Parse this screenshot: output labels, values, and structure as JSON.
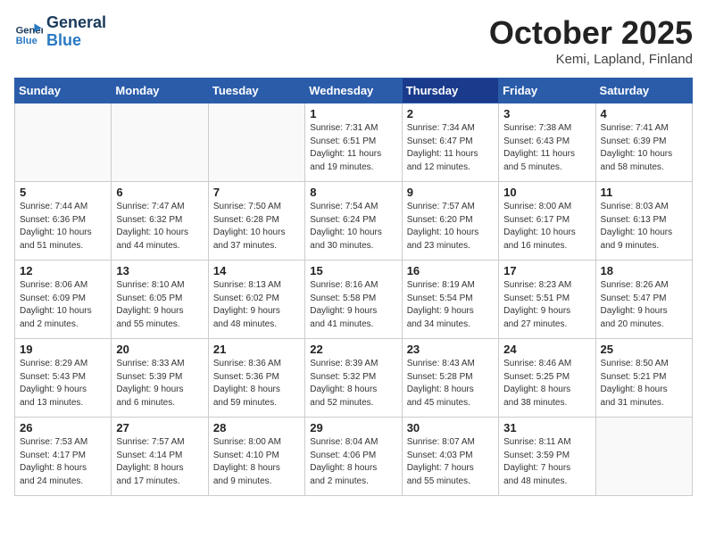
{
  "header": {
    "logo_line1": "General",
    "logo_line2": "Blue",
    "month": "October 2025",
    "location": "Kemi, Lapland, Finland"
  },
  "weekdays": [
    "Sunday",
    "Monday",
    "Tuesday",
    "Wednesday",
    "Thursday",
    "Friday",
    "Saturday"
  ],
  "weeks": [
    [
      {
        "day": "",
        "info": ""
      },
      {
        "day": "",
        "info": ""
      },
      {
        "day": "",
        "info": ""
      },
      {
        "day": "1",
        "info": "Sunrise: 7:31 AM\nSunset: 6:51 PM\nDaylight: 11 hours\nand 19 minutes."
      },
      {
        "day": "2",
        "info": "Sunrise: 7:34 AM\nSunset: 6:47 PM\nDaylight: 11 hours\nand 12 minutes."
      },
      {
        "day": "3",
        "info": "Sunrise: 7:38 AM\nSunset: 6:43 PM\nDaylight: 11 hours\nand 5 minutes."
      },
      {
        "day": "4",
        "info": "Sunrise: 7:41 AM\nSunset: 6:39 PM\nDaylight: 10 hours\nand 58 minutes."
      }
    ],
    [
      {
        "day": "5",
        "info": "Sunrise: 7:44 AM\nSunset: 6:36 PM\nDaylight: 10 hours\nand 51 minutes."
      },
      {
        "day": "6",
        "info": "Sunrise: 7:47 AM\nSunset: 6:32 PM\nDaylight: 10 hours\nand 44 minutes."
      },
      {
        "day": "7",
        "info": "Sunrise: 7:50 AM\nSunset: 6:28 PM\nDaylight: 10 hours\nand 37 minutes."
      },
      {
        "day": "8",
        "info": "Sunrise: 7:54 AM\nSunset: 6:24 PM\nDaylight: 10 hours\nand 30 minutes."
      },
      {
        "day": "9",
        "info": "Sunrise: 7:57 AM\nSunset: 6:20 PM\nDaylight: 10 hours\nand 23 minutes."
      },
      {
        "day": "10",
        "info": "Sunrise: 8:00 AM\nSunset: 6:17 PM\nDaylight: 10 hours\nand 16 minutes."
      },
      {
        "day": "11",
        "info": "Sunrise: 8:03 AM\nSunset: 6:13 PM\nDaylight: 10 hours\nand 9 minutes."
      }
    ],
    [
      {
        "day": "12",
        "info": "Sunrise: 8:06 AM\nSunset: 6:09 PM\nDaylight: 10 hours\nand 2 minutes."
      },
      {
        "day": "13",
        "info": "Sunrise: 8:10 AM\nSunset: 6:05 PM\nDaylight: 9 hours\nand 55 minutes."
      },
      {
        "day": "14",
        "info": "Sunrise: 8:13 AM\nSunset: 6:02 PM\nDaylight: 9 hours\nand 48 minutes."
      },
      {
        "day": "15",
        "info": "Sunrise: 8:16 AM\nSunset: 5:58 PM\nDaylight: 9 hours\nand 41 minutes."
      },
      {
        "day": "16",
        "info": "Sunrise: 8:19 AM\nSunset: 5:54 PM\nDaylight: 9 hours\nand 34 minutes."
      },
      {
        "day": "17",
        "info": "Sunrise: 8:23 AM\nSunset: 5:51 PM\nDaylight: 9 hours\nand 27 minutes."
      },
      {
        "day": "18",
        "info": "Sunrise: 8:26 AM\nSunset: 5:47 PM\nDaylight: 9 hours\nand 20 minutes."
      }
    ],
    [
      {
        "day": "19",
        "info": "Sunrise: 8:29 AM\nSunset: 5:43 PM\nDaylight: 9 hours\nand 13 minutes."
      },
      {
        "day": "20",
        "info": "Sunrise: 8:33 AM\nSunset: 5:39 PM\nDaylight: 9 hours\nand 6 minutes."
      },
      {
        "day": "21",
        "info": "Sunrise: 8:36 AM\nSunset: 5:36 PM\nDaylight: 8 hours\nand 59 minutes."
      },
      {
        "day": "22",
        "info": "Sunrise: 8:39 AM\nSunset: 5:32 PM\nDaylight: 8 hours\nand 52 minutes."
      },
      {
        "day": "23",
        "info": "Sunrise: 8:43 AM\nSunset: 5:28 PM\nDaylight: 8 hours\nand 45 minutes."
      },
      {
        "day": "24",
        "info": "Sunrise: 8:46 AM\nSunset: 5:25 PM\nDaylight: 8 hours\nand 38 minutes."
      },
      {
        "day": "25",
        "info": "Sunrise: 8:50 AM\nSunset: 5:21 PM\nDaylight: 8 hours\nand 31 minutes."
      }
    ],
    [
      {
        "day": "26",
        "info": "Sunrise: 7:53 AM\nSunset: 4:17 PM\nDaylight: 8 hours\nand 24 minutes."
      },
      {
        "day": "27",
        "info": "Sunrise: 7:57 AM\nSunset: 4:14 PM\nDaylight: 8 hours\nand 17 minutes."
      },
      {
        "day": "28",
        "info": "Sunrise: 8:00 AM\nSunset: 4:10 PM\nDaylight: 8 hours\nand 9 minutes."
      },
      {
        "day": "29",
        "info": "Sunrise: 8:04 AM\nSunset: 4:06 PM\nDaylight: 8 hours\nand 2 minutes."
      },
      {
        "day": "30",
        "info": "Sunrise: 8:07 AM\nSunset: 4:03 PM\nDaylight: 7 hours\nand 55 minutes."
      },
      {
        "day": "31",
        "info": "Sunrise: 8:11 AM\nSunset: 3:59 PM\nDaylight: 7 hours\nand 48 minutes."
      },
      {
        "day": "",
        "info": ""
      }
    ]
  ]
}
